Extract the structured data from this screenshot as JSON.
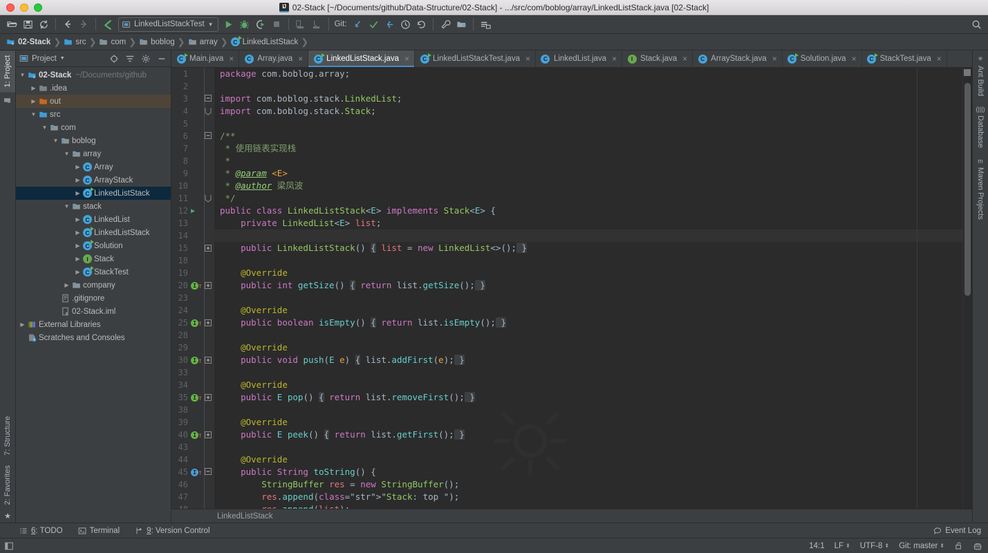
{
  "window": {
    "title": "02-Stack [~/Documents/github/Data-Structure/02-Stack] - .../src/com/boblog/array/LinkedListStack.java [02-Stack]",
    "logo_text": "IJ"
  },
  "toolbar": {
    "run_config": "LinkedListStackTest",
    "git_label": "Git:",
    "icons": [
      "open-folder-icon",
      "save-icon",
      "sync-icon",
      "back-arrow-icon",
      "forward-arrow-icon",
      "make-project-icon",
      "run-icon",
      "debug-icon",
      "run-coverage-icon",
      "stop-icon",
      "profile-icon",
      "attach-icon",
      "git-update-icon",
      "git-commit-icon",
      "git-push-icon",
      "history-icon",
      "revert-icon",
      "settings-wrench-icon",
      "project-structure-icon",
      "sdk-icon"
    ]
  },
  "breadcrumb": {
    "items": [
      {
        "label": "02-Stack",
        "icon": "module-icon"
      },
      {
        "label": "src",
        "icon": "source-folder-icon"
      },
      {
        "label": "com",
        "icon": "package-icon"
      },
      {
        "label": "boblog",
        "icon": "package-icon"
      },
      {
        "label": "array",
        "icon": "package-icon"
      },
      {
        "label": "LinkedListStack",
        "icon": "class-icon"
      }
    ]
  },
  "left_strip": {
    "top": [
      {
        "label": "1: Project",
        "active": true
      }
    ],
    "bottom": [
      {
        "label": "7: Structure"
      },
      {
        "label": "2: Favorites"
      }
    ]
  },
  "right_strip": {
    "items": [
      {
        "label": "Ant Build",
        "icon": "ant-icon"
      },
      {
        "label": "Database",
        "icon": "database-icon"
      },
      {
        "label": "Maven Projects",
        "icon": "maven-icon"
      }
    ]
  },
  "project_panel": {
    "title": "Project",
    "header_icons": [
      "locate-icon",
      "collapse-all-icon",
      "gear-icon",
      "hide-icon"
    ],
    "tree": [
      {
        "indent": 0,
        "arrow": "down",
        "icon": "module-icon",
        "label": "02-Stack",
        "sub": "~/Documents/github",
        "bold": true,
        "state": "normal"
      },
      {
        "indent": 1,
        "arrow": "right",
        "icon": "folder-icon",
        "label": ".idea",
        "sub": "",
        "bold": false,
        "state": "normal"
      },
      {
        "indent": 1,
        "arrow": "right",
        "icon": "folder-out-icon",
        "label": "out",
        "sub": "",
        "bold": false,
        "state": "highlight"
      },
      {
        "indent": 1,
        "arrow": "down",
        "icon": "source-folder-icon",
        "label": "src",
        "sub": "",
        "bold": false,
        "state": "normal"
      },
      {
        "indent": 2,
        "arrow": "down",
        "icon": "package-icon",
        "label": "com",
        "sub": "",
        "bold": false,
        "state": "normal"
      },
      {
        "indent": 3,
        "arrow": "down",
        "icon": "package-icon",
        "label": "boblog",
        "sub": "",
        "bold": false,
        "state": "normal"
      },
      {
        "indent": 4,
        "arrow": "down",
        "icon": "package-icon",
        "label": "array",
        "sub": "",
        "bold": false,
        "state": "normal"
      },
      {
        "indent": 5,
        "arrow": "right",
        "icon": "class-icon",
        "label": "Array",
        "sub": "",
        "bold": false,
        "state": "normal"
      },
      {
        "indent": 5,
        "arrow": "right",
        "icon": "class-icon",
        "label": "ArrayStack",
        "sub": "",
        "bold": false,
        "state": "normal"
      },
      {
        "indent": 5,
        "arrow": "right",
        "icon": "class-run-icon",
        "label": "LinkedListStack",
        "sub": "",
        "bold": false,
        "state": "selected"
      },
      {
        "indent": 4,
        "arrow": "down",
        "icon": "package-icon",
        "label": "stack",
        "sub": "",
        "bold": false,
        "state": "normal"
      },
      {
        "indent": 5,
        "arrow": "right",
        "icon": "class-icon",
        "label": "LinkedList",
        "sub": "",
        "bold": false,
        "state": "normal"
      },
      {
        "indent": 5,
        "arrow": "right",
        "icon": "class-run-icon",
        "label": "LinkedListStack",
        "sub": "",
        "bold": false,
        "state": "normal",
        "clip": true
      },
      {
        "indent": 5,
        "arrow": "right",
        "icon": "class-run-icon",
        "label": "Solution",
        "sub": "",
        "bold": false,
        "state": "normal"
      },
      {
        "indent": 5,
        "arrow": "right",
        "icon": "interface-icon",
        "label": "Stack",
        "sub": "",
        "bold": false,
        "state": "normal"
      },
      {
        "indent": 5,
        "arrow": "right",
        "icon": "class-run-icon",
        "label": "StackTest",
        "sub": "",
        "bold": false,
        "state": "normal"
      },
      {
        "indent": 4,
        "arrow": "right",
        "icon": "package-icon",
        "label": "company",
        "sub": "",
        "bold": false,
        "state": "normal"
      },
      {
        "indent": 3,
        "arrow": "none",
        "icon": "gitignore-icon",
        "label": ".gitignore",
        "sub": "",
        "bold": false,
        "state": "normal"
      },
      {
        "indent": 3,
        "arrow": "none",
        "icon": "iml-icon",
        "label": "02-Stack.iml",
        "sub": "",
        "bold": false,
        "state": "normal"
      },
      {
        "indent": 0,
        "arrow": "right",
        "icon": "libraries-icon",
        "label": "External Libraries",
        "sub": "",
        "bold": false,
        "state": "normal"
      },
      {
        "indent": 0,
        "arrow": "none",
        "icon": "scratches-icon",
        "label": "Scratches and Consoles",
        "sub": "",
        "bold": false,
        "state": "normal"
      }
    ]
  },
  "editor_tabs": [
    {
      "label": "Main.java",
      "icon": "class-run-icon",
      "active": false
    },
    {
      "label": "Array.java",
      "icon": "class-icon",
      "active": false
    },
    {
      "label": "LinkedListStack.java",
      "icon": "class-run-icon",
      "active": true
    },
    {
      "label": "LinkedListStackTest.java",
      "icon": "class-run-icon",
      "active": false
    },
    {
      "label": "LinkedList.java",
      "icon": "class-icon",
      "active": false
    },
    {
      "label": "Stack.java",
      "icon": "interface-icon",
      "active": false
    },
    {
      "label": "ArrayStack.java",
      "icon": "class-icon",
      "active": false
    },
    {
      "label": "Solution.java",
      "icon": "class-run-icon",
      "active": false
    },
    {
      "label": "StackTest.java",
      "icon": "class-run-icon",
      "active": false
    }
  ],
  "editor": {
    "lines": [
      {
        "num": "1",
        "gutter": "",
        "fold": "",
        "cur": false
      },
      {
        "num": "2",
        "gutter": "",
        "fold": "",
        "cur": false
      },
      {
        "num": "3",
        "gutter": "",
        "fold": "minus-top",
        "cur": false
      },
      {
        "num": "4",
        "gutter": "",
        "fold": "minus-bot",
        "cur": false
      },
      {
        "num": "5",
        "gutter": "",
        "fold": "",
        "cur": false
      },
      {
        "num": "6",
        "gutter": "",
        "fold": "minus-top",
        "cur": false
      },
      {
        "num": "7",
        "gutter": "",
        "fold": "",
        "cur": false
      },
      {
        "num": "8",
        "gutter": "",
        "fold": "",
        "cur": false
      },
      {
        "num": "9",
        "gutter": "",
        "fold": "",
        "cur": false
      },
      {
        "num": "10",
        "gutter": "",
        "fold": "",
        "cur": false
      },
      {
        "num": "11",
        "gutter": "",
        "fold": "minus-bot",
        "cur": false
      },
      {
        "num": "12",
        "gutter": "run",
        "fold": "",
        "cur": false
      },
      {
        "num": "13",
        "gutter": "",
        "fold": "",
        "cur": false
      },
      {
        "num": "14",
        "gutter": "",
        "fold": "",
        "cur": true
      },
      {
        "num": "15",
        "gutter": "",
        "fold": "plus",
        "cur": false
      },
      {
        "num": "18",
        "gutter": "",
        "fold": "",
        "cur": false
      },
      {
        "num": "19",
        "gutter": "",
        "fold": "",
        "cur": false
      },
      {
        "num": "20",
        "gutter": "impl",
        "fold": "plus",
        "cur": false
      },
      {
        "num": "23",
        "gutter": "",
        "fold": "",
        "cur": false
      },
      {
        "num": "24",
        "gutter": "",
        "fold": "",
        "cur": false
      },
      {
        "num": "25",
        "gutter": "impl",
        "fold": "plus",
        "cur": false
      },
      {
        "num": "28",
        "gutter": "",
        "fold": "",
        "cur": false
      },
      {
        "num": "29",
        "gutter": "",
        "fold": "",
        "cur": false
      },
      {
        "num": "30",
        "gutter": "impl",
        "fold": "plus",
        "cur": false
      },
      {
        "num": "33",
        "gutter": "",
        "fold": "",
        "cur": false
      },
      {
        "num": "34",
        "gutter": "",
        "fold": "",
        "cur": false
      },
      {
        "num": "35",
        "gutter": "impl",
        "fold": "plus",
        "cur": false
      },
      {
        "num": "38",
        "gutter": "",
        "fold": "",
        "cur": false
      },
      {
        "num": "39",
        "gutter": "",
        "fold": "",
        "cur": false
      },
      {
        "num": "40",
        "gutter": "impl",
        "fold": "plus",
        "cur": false
      },
      {
        "num": "43",
        "gutter": "",
        "fold": "",
        "cur": false
      },
      {
        "num": "44",
        "gutter": "",
        "fold": "",
        "cur": false
      },
      {
        "num": "45",
        "gutter": "impl-blue",
        "fold": "minus-top",
        "cur": false
      },
      {
        "num": "46",
        "gutter": "",
        "fold": "",
        "cur": false
      },
      {
        "num": "47",
        "gutter": "",
        "fold": "",
        "cur": false
      },
      {
        "num": "48",
        "gutter": "",
        "fold": "",
        "cur": false
      }
    ],
    "code_text": [
      "package com.boblog.array;",
      "",
      "import com.boblog.stack.LinkedList;",
      "import com.boblog.stack.Stack;",
      "",
      "/**",
      " * 使用链表实现栈",
      " *",
      " * @param <E>",
      " * @author 梁凤波",
      " */",
      "public class LinkedListStack<E> implements Stack<E> {",
      "    private LinkedList<E> list;",
      "",
      "    public LinkedListStack() { list = new LinkedList<>(); }",
      "",
      "    @Override",
      "    public int getSize() { return list.getSize(); }",
      "",
      "    @Override",
      "    public boolean isEmpty() { return list.isEmpty(); }",
      "",
      "    @Override",
      "    public void push(E e) { list.addFirst(e); }",
      "",
      "    @Override",
      "    public E pop() { return list.removeFirst(); }",
      "",
      "    @Override",
      "    public E peek() { return list.getFirst(); }",
      "",
      "    @Override",
      "    public String toString() {",
      "        StringBuffer res = new StringBuffer();",
      "        res.append(\"Stack: top \");",
      "        res.append(list);"
    ]
  },
  "sub_breadcrumb": {
    "label": "LinkedListStack"
  },
  "tool_window_bar": {
    "items": [
      {
        "num": "6",
        "label": ": TODO",
        "icon": "todo-icon"
      },
      {
        "num": "",
        "label": "Terminal",
        "icon": "terminal-icon"
      },
      {
        "num": "9",
        "label": ": Version Control",
        "icon": "vcs-icon"
      }
    ],
    "event_log": "Event Log"
  },
  "status_bar": {
    "position": "14:1",
    "line_sep": "LF",
    "encoding": "UTF-8",
    "branch": "Git: master",
    "icons": [
      "lock-open-icon",
      "build-icon",
      "notification-icon"
    ]
  },
  "colors": {
    "accent": "#4a88c7",
    "panel_bg": "#3c3f41",
    "editor_bg": "#2b2b2b",
    "gutter_bg": "#313335",
    "selected_row": "#0d293e",
    "highlight_row": "#4e4538"
  }
}
